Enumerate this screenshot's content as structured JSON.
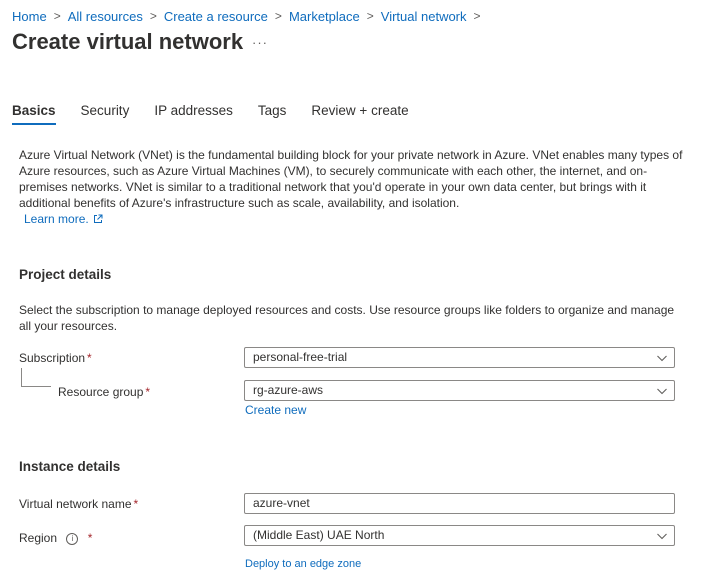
{
  "breadcrumb": [
    "Home",
    "All resources",
    "Create a resource",
    "Marketplace",
    "Virtual network"
  ],
  "page": {
    "title": "Create virtual network",
    "more_label": "···"
  },
  "tabs": [
    "Basics",
    "Security",
    "IP addresses",
    "Tags",
    "Review + create"
  ],
  "active_tab": "Basics",
  "description": "Azure Virtual Network (VNet) is the fundamental building block for your private network in Azure. VNet enables many types of Azure resources, such as Azure Virtual Machines (VM), to securely communicate with each other, the internet, and on-premises networks. VNet is similar to a traditional network that you'd operate in your own data center, but brings with it additional benefits of Azure's infrastructure such as scale, availability, and isolation.",
  "learn_more": "Learn more.",
  "project": {
    "title": "Project details",
    "description": "Select the subscription to manage deployed resources and costs. Use resource groups like folders to organize and manage all your resources.",
    "subscription_label": "Subscription",
    "subscription_value": "personal-free-trial",
    "resource_group_label": "Resource group",
    "resource_group_value": "rg-azure-aws",
    "create_new": "Create new"
  },
  "instance": {
    "title": "Instance details",
    "vnet_name_label": "Virtual network name",
    "vnet_name_value": "azure-vnet",
    "region_label": "Region",
    "region_value": "(Middle East) UAE North",
    "edge_zone_link": "Deploy to an edge zone"
  },
  "required_marker": "*",
  "colors": {
    "link": "#0f6cbd",
    "required": "#a4262c",
    "text": "#323130",
    "border": "#8a8886"
  }
}
